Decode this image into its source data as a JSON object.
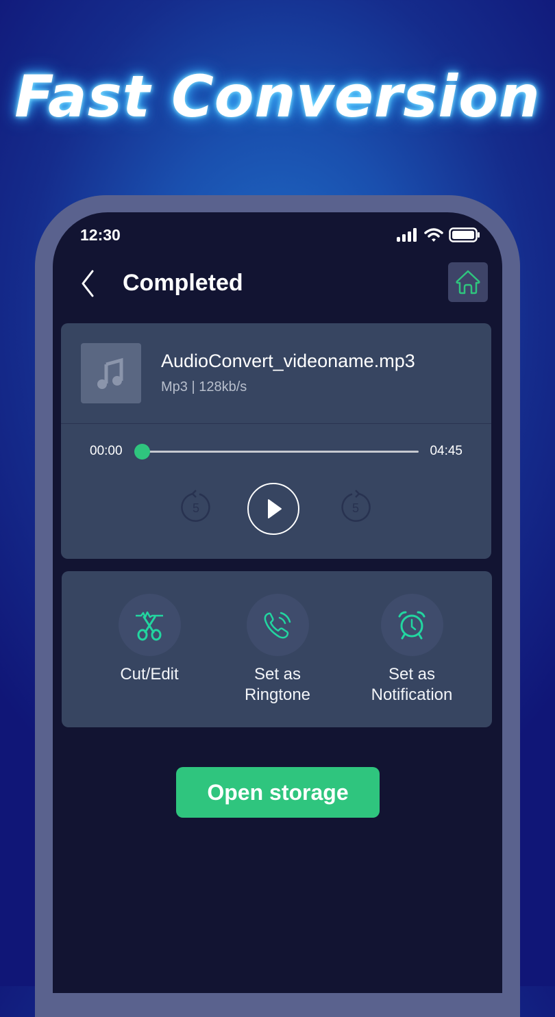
{
  "promo": {
    "headline": "Fast Conversion"
  },
  "status_bar": {
    "time": "12:30",
    "icons": [
      "signal-icon",
      "wifi-icon",
      "battery-icon"
    ]
  },
  "header": {
    "title": "Completed",
    "back_icon": "chevron-left-icon",
    "home_icon": "home-icon"
  },
  "file": {
    "name": "AudioConvert_videoname.mp3",
    "meta": "Mp3 | 128kb/s",
    "thumbnail_icon": "music-note-icon"
  },
  "player": {
    "current_time": "00:00",
    "total_time": "04:45",
    "progress_fraction": 0,
    "rewind_seconds": "5",
    "forward_seconds": "5"
  },
  "actions": [
    {
      "label_line1": "Cut/Edit",
      "label_line2": "",
      "icon": "scissors-icon"
    },
    {
      "label_line1": "Set as",
      "label_line2": "Ringtone",
      "icon": "phone-ringing-icon"
    },
    {
      "label_line1": "Set as",
      "label_line2": "Notification",
      "icon": "alarm-clock-icon"
    }
  ],
  "open_storage_label": "Open storage",
  "colors": {
    "accent": "#2fc57e",
    "icon_accent": "#22d6a0",
    "card": "#374561",
    "screen": "#121432"
  }
}
